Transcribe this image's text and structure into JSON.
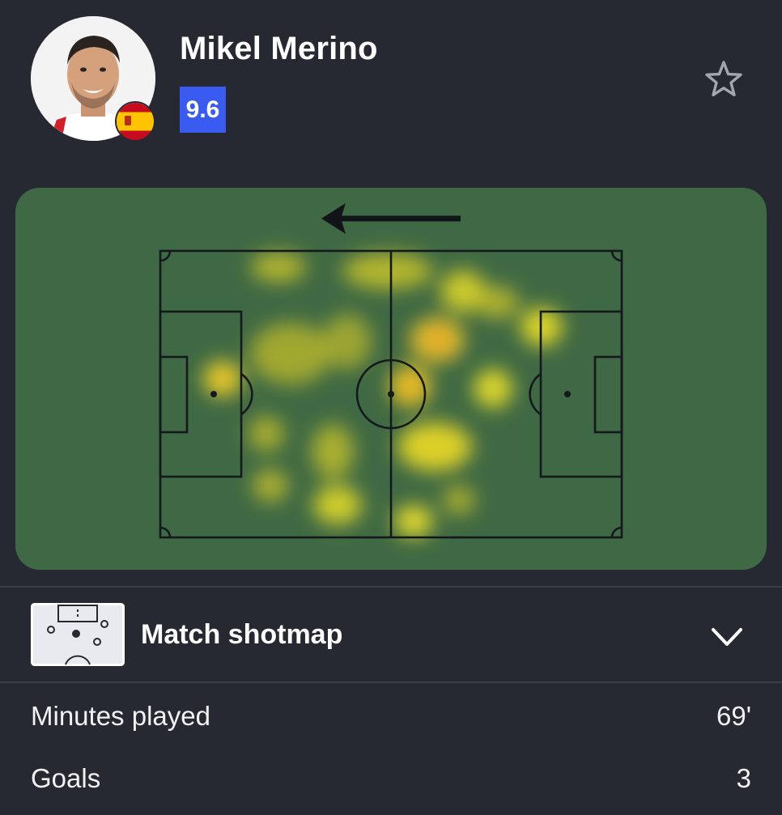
{
  "player": {
    "name": "Mikel Merino",
    "rating": "9.6",
    "nationality_icon": "spain-flag-icon",
    "rating_color": "#3a5bf0"
  },
  "heatmap": {
    "pitch_color": "#3f6944",
    "attack_direction": "left"
  },
  "shotmap": {
    "label": "Match shotmap"
  },
  "stats": [
    {
      "label": "Minutes played",
      "value": "69'"
    },
    {
      "label": "Goals",
      "value": "3"
    }
  ]
}
